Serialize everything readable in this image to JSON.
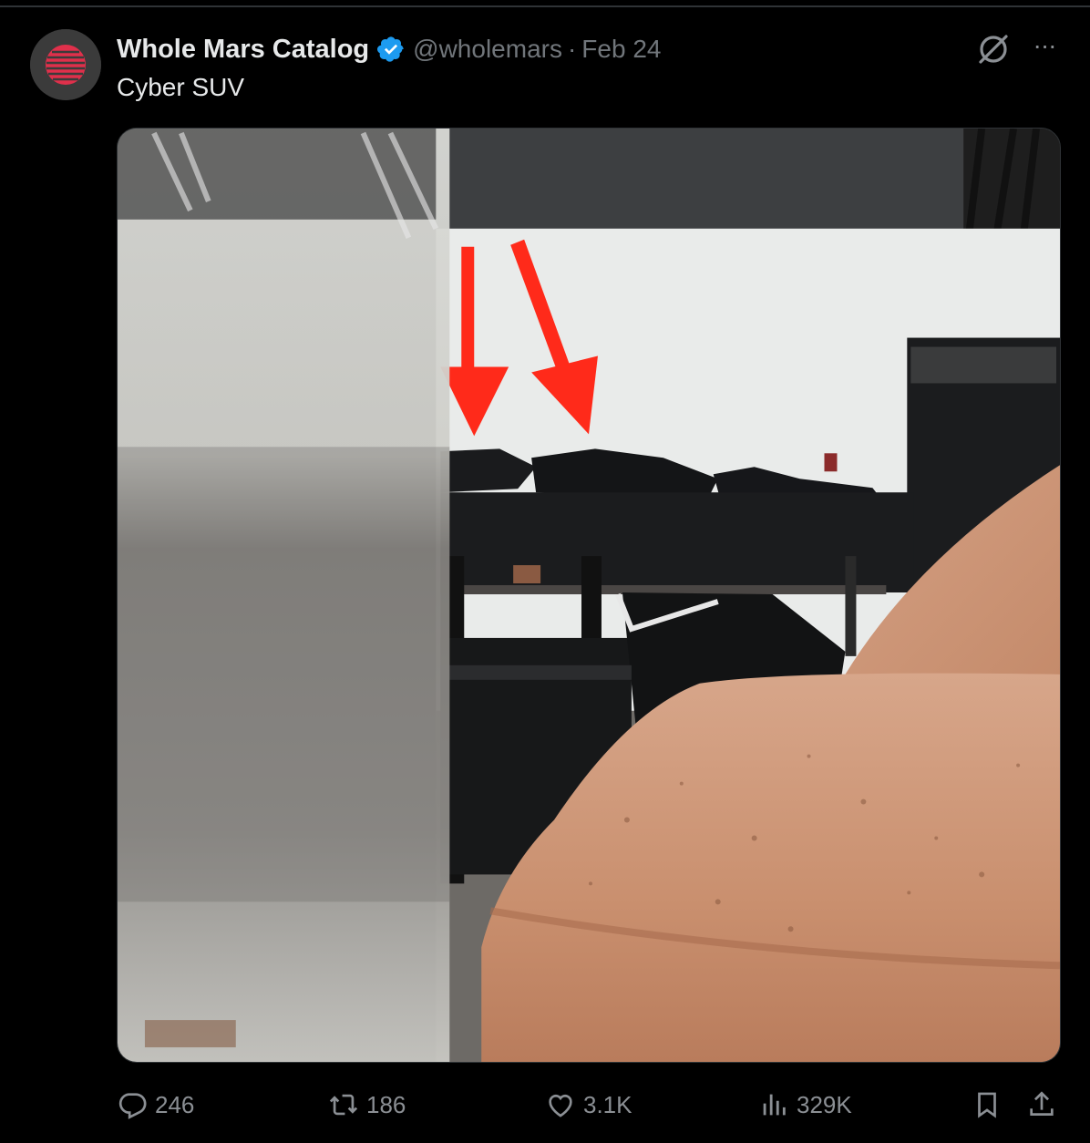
{
  "tweet": {
    "display_name": "Whole Mars Catalog",
    "handle": "@wholemars",
    "separator": "·",
    "date": "Feb 24",
    "text": "Cyber SUV",
    "verified": true,
    "avatar_icon": "mars-globe-logo"
  },
  "header_icons": {
    "grok": "grok-icon",
    "more": "more-icon",
    "more_glyph": "···"
  },
  "media": {
    "description_icon": "photo",
    "arrow_color": "#ff2a1a",
    "clay_color": "#c98f6e"
  },
  "actions": {
    "replies": "246",
    "reposts": "186",
    "likes": "3.1K",
    "views": "329K"
  },
  "colors": {
    "background": "#000000",
    "text_primary": "#e7e9ea",
    "text_secondary": "#71767b",
    "verified": "#1d9bf0"
  }
}
